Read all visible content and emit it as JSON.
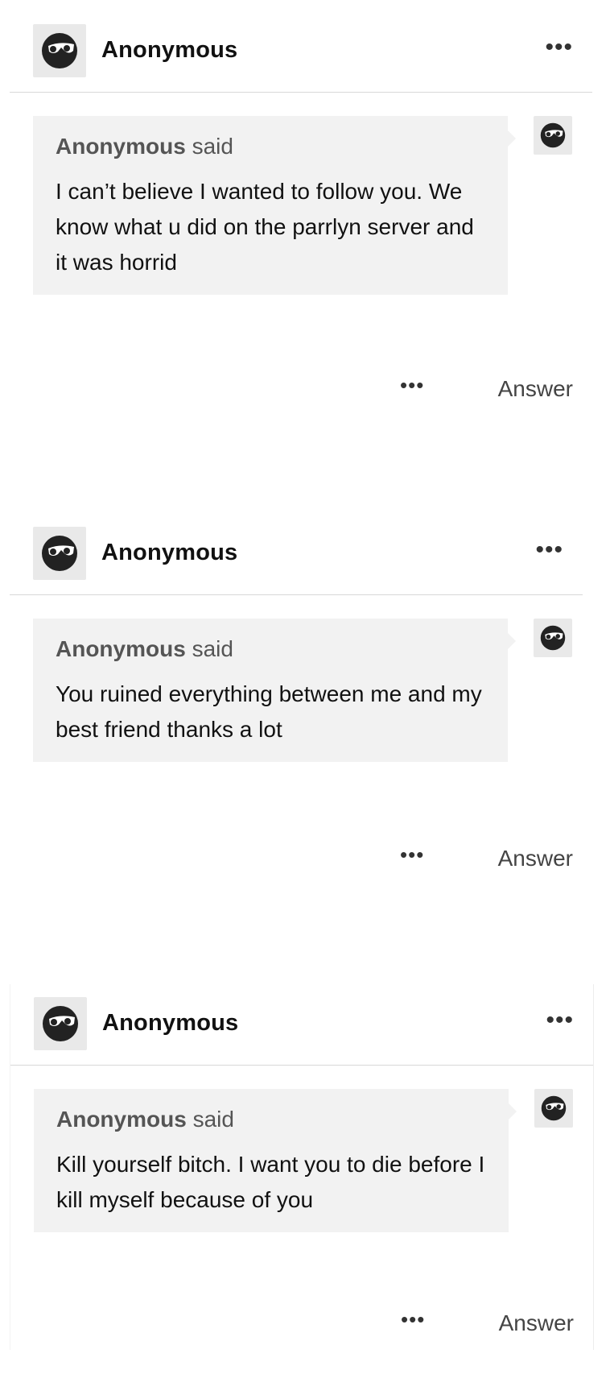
{
  "colors": {
    "background": "#ffffff",
    "bubble": "#f2f2f2",
    "divider": "#d8d8d8",
    "avatar_bg": "#e9e9e9"
  },
  "icons": {
    "avatar": "sunglasses-face-icon",
    "more": "ellipsis-icon"
  },
  "asks": [
    {
      "blog_name": "Anonymous",
      "more_label": "•••",
      "asker": "Anonymous",
      "said_label": "said",
      "message": "I can’t believe I wanted to follow you. We know what u did on the parrlyn server and it was horrid",
      "answer_label": "Answer"
    },
    {
      "blog_name": "Anonymous",
      "more_label": "•••",
      "asker": "Anonymous",
      "said_label": "said",
      "message": "You ruined everything between me and my best friend thanks a lot",
      "answer_label": "Answer"
    },
    {
      "blog_name": "Anonymous",
      "more_label": "•••",
      "asker": "Anonymous",
      "said_label": "said",
      "message": "Kill yourself bitch. I want you to die before I kill myself because of you",
      "answer_label": "Answer"
    }
  ]
}
